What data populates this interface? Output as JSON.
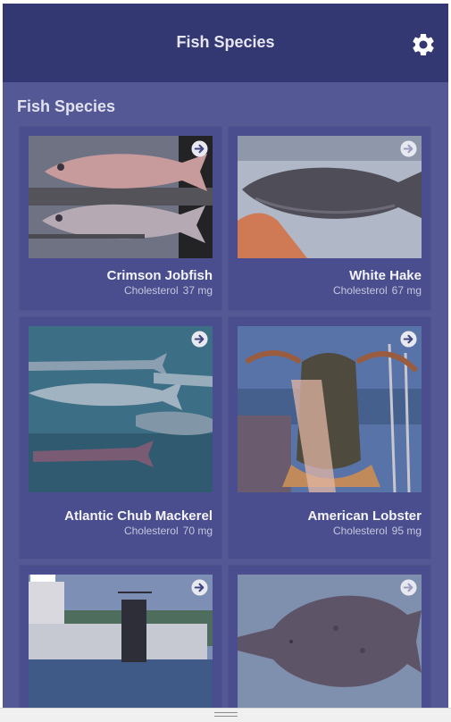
{
  "app_bar": {
    "title": "Fish Species",
    "settings_icon": "gear-icon"
  },
  "section": {
    "title": "Fish Species"
  },
  "nutrient_label": "Cholesterol",
  "species": [
    {
      "name": "Crimson Jobfish",
      "cholesterol": "37 mg"
    },
    {
      "name": "White Hake",
      "cholesterol": "67 mg"
    },
    {
      "name": "Atlantic Chub Mackerel",
      "cholesterol": "70 mg"
    },
    {
      "name": "American Lobster",
      "cholesterol": "95 mg"
    },
    {
      "name": "",
      "cholesterol": ""
    },
    {
      "name": "",
      "cholesterol": ""
    }
  ],
  "card_icon": "arrow-right-circle-icon",
  "colors": {
    "app_bar": "#343872",
    "background": "#545894",
    "card": "#4a4e8e"
  }
}
